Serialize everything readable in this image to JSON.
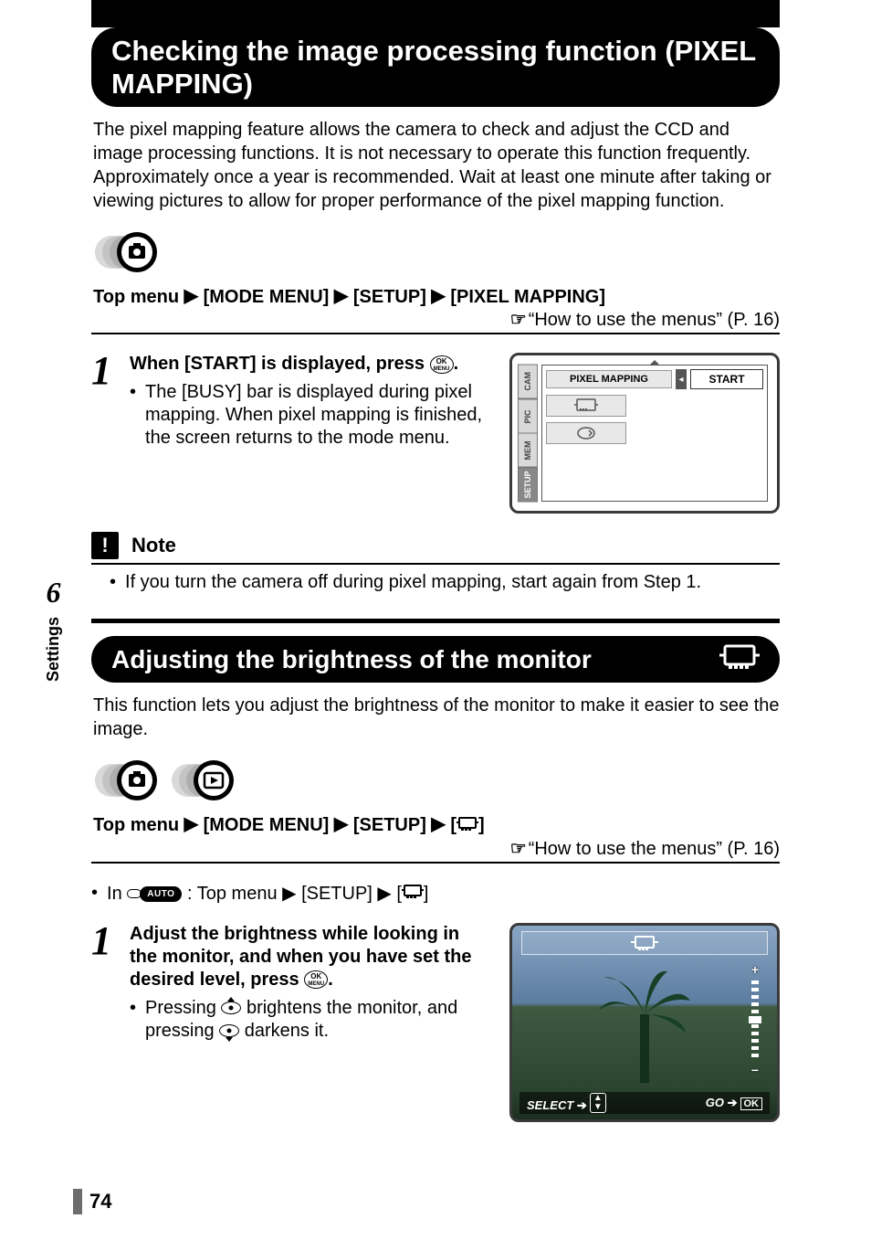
{
  "page_number": "74",
  "side": {
    "chapter": "6",
    "label": "Settings"
  },
  "section1": {
    "title": "Checking the image processing function (PIXEL MAPPING)",
    "intro": "The pixel mapping feature allows the camera to check and adjust the CCD and image processing functions. It is not necessary to operate this function frequently. Approximately once a year is recommended. Wait at least one minute after taking or viewing pictures to allow for proper performance of the pixel mapping function.",
    "breadcrumb": {
      "prefix": "Top menu",
      "items": [
        "[MODE MENU]",
        "[SETUP]",
        "[PIXEL MAPPING]"
      ]
    },
    "crossref": "“How to use the menus” (P. 16)",
    "step": {
      "num": "1",
      "title_a": "When [START] is displayed, press ",
      "title_b": ".",
      "bullet": "The [BUSY] bar is displayed during pixel mapping. When pixel mapping is finished, the screen returns to the mode menu."
    },
    "screen": {
      "tabs": [
        "CAM",
        "PIC",
        "MEM",
        "SETUP"
      ],
      "active_tab": "SETUP",
      "label": "PIXEL MAPPING",
      "value": "START"
    },
    "note": {
      "title": "Note",
      "item": "If you turn the camera off during pixel mapping, start again from Step 1."
    }
  },
  "section2": {
    "title": "Adjusting the brightness of the monitor",
    "intro": "This function lets you adjust the brightness of the monitor to make it easier to see the image.",
    "breadcrumb": {
      "prefix": "Top menu",
      "items": [
        "[MODE MENU]",
        "[SETUP]"
      ],
      "final_icon": "monitor-brightness-icon"
    },
    "crossref": "“How to use the menus” (P. 16)",
    "subnote": {
      "prefix": "In",
      "auto": "AUTO",
      "text": ": Top menu ▶ [SETUP] ▶ [",
      "text_end": "]"
    },
    "step": {
      "num": "1",
      "title": "Adjust the brightness while looking in the monitor, and when you have set the desired level, press ",
      "title_end": ".",
      "bullet_a": "Pressing ",
      "bullet_b": " brightens the monitor, and pressing ",
      "bullet_c": " darkens it."
    },
    "bscreen": {
      "select": "SELECT",
      "go": "GO",
      "ok": "OK"
    }
  },
  "ok_button": {
    "top": "OK",
    "bottom": "MENU"
  }
}
